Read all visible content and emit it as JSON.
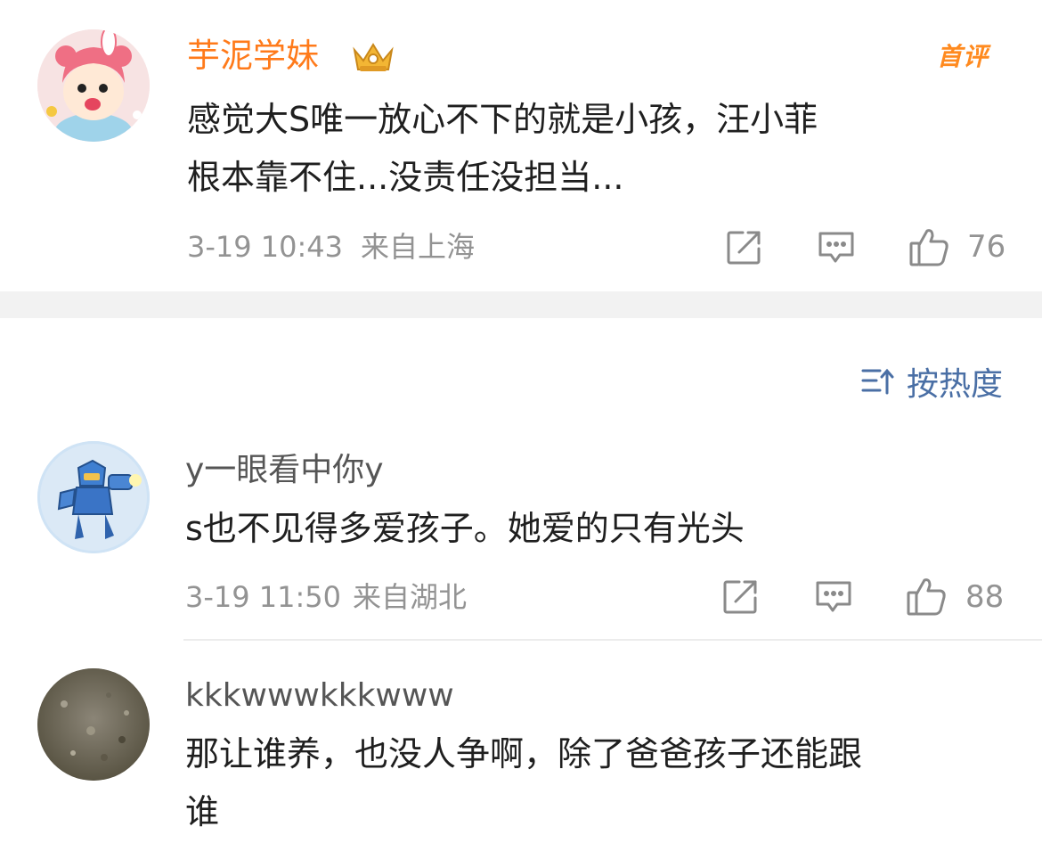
{
  "featured_comment": {
    "username": "芋泥学妹",
    "badge_label": "首评",
    "text_lines": [
      "感觉大S唯一放心不下的就是小孩，汪小菲",
      "根本靠不住...没责任没担当..."
    ],
    "timestamp": "3-19 10:43",
    "location": "来自上海",
    "likes": "76",
    "username_color": "#ff7a1a"
  },
  "sort": {
    "label": "按热度",
    "icon": "sort-icon"
  },
  "comments": [
    {
      "username": "y一眼看中你y",
      "text_lines": [
        "s也不见得多爱孩子。她爱的只有光头"
      ],
      "timestamp": "3-19 11:50",
      "location": "来自湖北",
      "likes": "88"
    },
    {
      "username": "kkkwwwkkkwww",
      "text_lines": [
        "那让谁养，也没人争啊，除了爸爸孩子还能跟",
        "谁"
      ]
    }
  ]
}
